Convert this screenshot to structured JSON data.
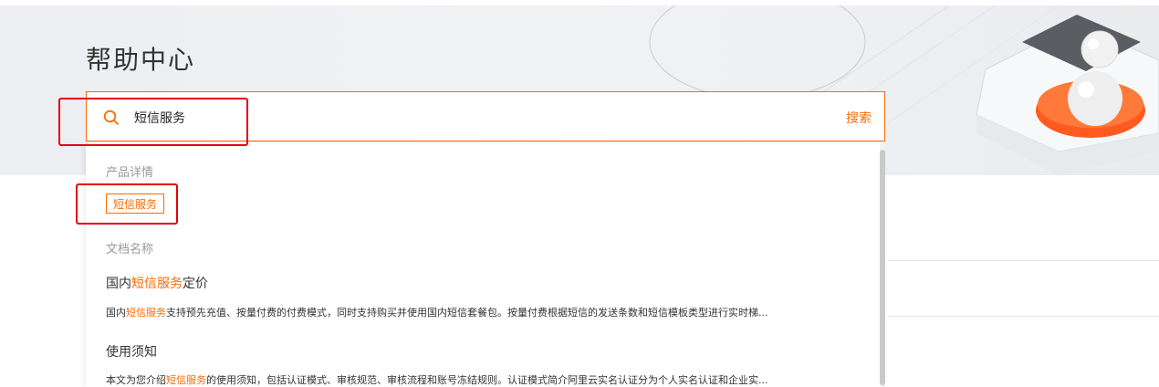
{
  "header": {
    "title": "帮助中心"
  },
  "search": {
    "value": "短信服务",
    "button_label": "搜索"
  },
  "dropdown": {
    "product_section_label": "产品详情",
    "product_tag": "短信服务",
    "docs_section_label": "文档名称",
    "docs": [
      {
        "title_pre": "国内",
        "title_hl": "短信服务",
        "title_post": "定价",
        "desc_pre": "国内",
        "desc_hl": "短信服务",
        "desc_post": "支持预先充值、按量付费的付费模式，同时支持购买并使用国内短信套餐包。按量付费根据短信的发送条数和短信模板类型进行实时梯..."
      },
      {
        "title_pre": "使用须知",
        "title_hl": "",
        "title_post": "",
        "desc_pre": "本文为您介绍",
        "desc_hl": "短信服务",
        "desc_post": "的使用须知，包括认证模式、审核规范、审核流程和账号冻结规则。认证模式简介阿里云实名认证分为个人实名认证和企业实..."
      }
    ]
  },
  "colors": {
    "accent": "#ff6a00",
    "annotation_red": "#e60012"
  },
  "icons": {
    "search": "search-icon"
  }
}
